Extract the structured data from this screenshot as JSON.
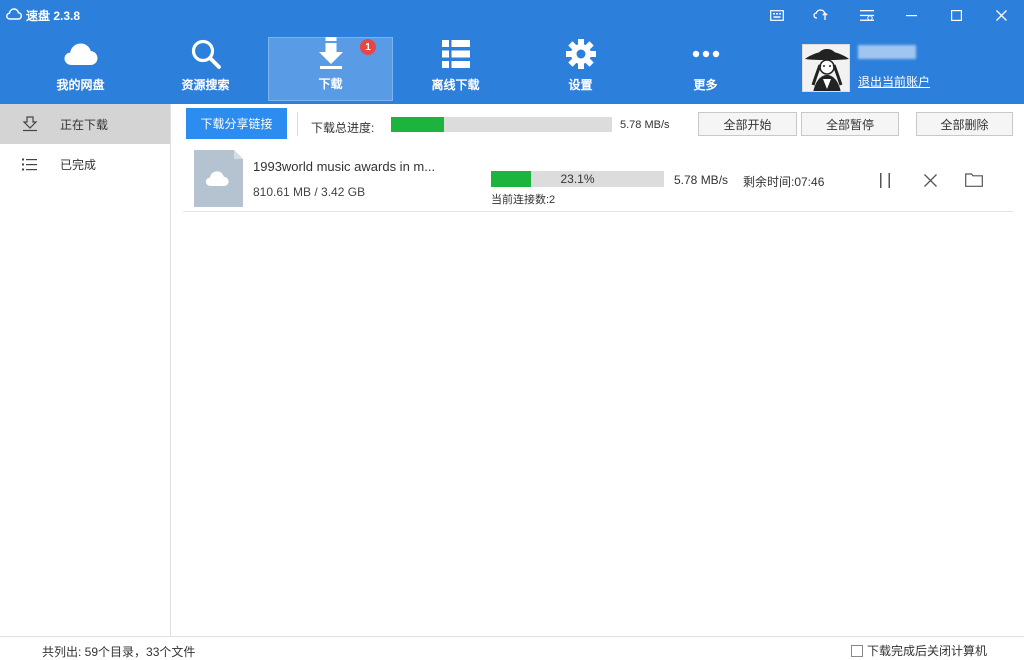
{
  "app": {
    "title": "速盘 2.3.8"
  },
  "nav": {
    "items": [
      {
        "label": "我的网盘",
        "icon": "cloud-icon"
      },
      {
        "label": "资源搜索",
        "icon": "search-icon"
      },
      {
        "label": "下载",
        "icon": "download-arrow-icon",
        "badge": "1",
        "active": true
      },
      {
        "label": "离线下载",
        "icon": "list-grid-icon"
      },
      {
        "label": "设置",
        "icon": "gear-icon"
      },
      {
        "label": "更多",
        "icon": "more-dots-icon"
      }
    ]
  },
  "user": {
    "logout_label": "退出当前账户"
  },
  "sidebar": {
    "items": [
      {
        "label": "正在下载",
        "icon": "download-tray-icon",
        "active": true
      },
      {
        "label": "已完成",
        "icon": "list-icon"
      }
    ]
  },
  "toolbar": {
    "share_label": "下载分享链接",
    "total_label": "下载总进度:",
    "total_progress": 0.24,
    "total_speed": "5.78 MB/s",
    "start_all_label": "全部开始",
    "pause_all_label": "全部暂停",
    "delete_all_label": "全部删除"
  },
  "downloads": [
    {
      "name": "1993world music awards in m...",
      "size": "810.61 MB / 3.42 GB",
      "progress_percent": 23.1,
      "progress_text": "23.1%",
      "speed": "5.78 MB/s",
      "remaining": "剩余时间:07:46",
      "connections": "当前连接数:2"
    }
  ],
  "status": {
    "summary": "共列出: 59个目录，33个文件",
    "shutdown_label": "下载完成后关闭计算机"
  },
  "colors": {
    "header_bg": "#2d7fdc",
    "nav_active_bg": "#5a9be6",
    "progress_fill": "#1cb43c",
    "badge_bg": "#e84545",
    "primary_button": "#2d8cf0"
  }
}
